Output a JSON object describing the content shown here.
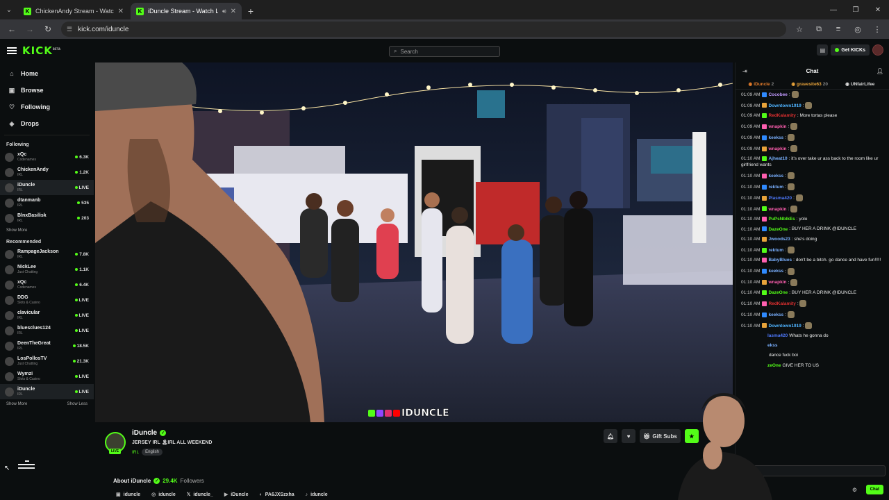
{
  "browser": {
    "tabs": [
      {
        "title": "ChickenAndy Stream - Watch Li"
      },
      {
        "title": "iDuncle Stream - Watch Live"
      }
    ],
    "url": "kick.com/iduncle"
  },
  "header": {
    "logo": "KICK",
    "logo_sup": "BETA",
    "search_placeholder": "Search",
    "get_kicks": "Get KICKs"
  },
  "sidebar": {
    "nav": [
      {
        "label": "Home",
        "icon": "home-icon"
      },
      {
        "label": "Browse",
        "icon": "browse-icon"
      },
      {
        "label": "Following",
        "icon": "heart-icon"
      },
      {
        "label": "Drops",
        "icon": "drop-icon"
      }
    ],
    "following_title": "Following",
    "following": [
      {
        "name": "xQc",
        "cat": "Codenames",
        "viewers": "6.3K"
      },
      {
        "name": "ChickenAndy",
        "cat": "IRL",
        "viewers": "1.2K"
      },
      {
        "name": "iDuncle",
        "cat": "IRL",
        "viewers": "LIVE"
      },
      {
        "name": "dtanmanb",
        "cat": "IRL",
        "viewers": "535"
      },
      {
        "name": "BlnxBasilisk",
        "cat": "IRL",
        "viewers": "203"
      }
    ],
    "show_more_1": "Show More",
    "recommended_title": "Recommended",
    "recommended": [
      {
        "name": "RampageJackson",
        "cat": "IRL",
        "viewers": "7.8K"
      },
      {
        "name": "NickLee",
        "cat": "Just Chatting",
        "viewers": "1.1K"
      },
      {
        "name": "xQc",
        "cat": "Codenames",
        "viewers": "6.4K"
      },
      {
        "name": "DDG",
        "cat": "Slots & Casino",
        "viewers": "LIVE"
      },
      {
        "name": "clavicular",
        "cat": "IRL",
        "viewers": "LIVE"
      },
      {
        "name": "bluesclues124",
        "cat": "IRL",
        "viewers": "LIVE"
      },
      {
        "name": "DeenTheGreat",
        "cat": "IRL",
        "viewers": "18.5K"
      },
      {
        "name": "LosPollosTV",
        "cat": "Just Chatting",
        "viewers": "21.3K"
      },
      {
        "name": "Wymzi",
        "cat": "Slots & Casino",
        "viewers": "LIVE"
      },
      {
        "name": "iDuncle",
        "cat": "IRL",
        "viewers": "LIVE"
      }
    ],
    "show_more_2": "Show More",
    "show_less": "Show Less"
  },
  "video": {
    "watermark": "IDUNCLE"
  },
  "streamer": {
    "name": "iDuncle",
    "live_tag": "LIVE",
    "title": "JERSEY IRL 🏝IRL ALL WEEKEND",
    "category": "IRL",
    "tag": "English",
    "gift_subs": "Gift Subs",
    "about_label": "About iDuncle",
    "followers": "29.4K",
    "followers_label": "Followers",
    "socials": [
      "iduncle",
      "iduncle",
      "iduncle_",
      "iDuncle",
      "PA6JXSzxha",
      "iduncle"
    ]
  },
  "chat": {
    "title": "Chat",
    "gifters": [
      {
        "name": "iDuncle",
        "count": "2",
        "color": "#e07a2a"
      },
      {
        "name": "gravesite63",
        "count": "20",
        "color": "#e8a33a"
      },
      {
        "name": "UNfairLifee",
        "count": "",
        "color": "#dddddd"
      }
    ],
    "messages": [
      {
        "time": "01:09 AM",
        "user": "Cocobee",
        "color": "#c39bff",
        "text": ""
      },
      {
        "time": "01:09 AM",
        "user": "Downtown1919",
        "color": "#4fb3ff",
        "text": ""
      },
      {
        "time": "01:09 AM",
        "user": "RedKalamity",
        "color": "#e03030",
        "text": "More tortas please"
      },
      {
        "time": "01:09 AM",
        "user": "wnapkin",
        "color": "#ff5fb0",
        "text": ""
      },
      {
        "time": "01:09 AM",
        "user": "keekss",
        "color": "#7ab0ff",
        "text": ""
      },
      {
        "time": "01:09 AM",
        "user": "wnapkin",
        "color": "#ff5fb0",
        "text": ""
      },
      {
        "time": "01:10 AM",
        "user": "Ajheat10",
        "color": "#7ab0ff",
        "text": "it's over take ur ass back to the room like ur girlfriend wants"
      },
      {
        "time": "01:10 AM",
        "user": "keekss",
        "color": "#7ab0ff",
        "text": ""
      },
      {
        "time": "01:10 AM",
        "user": "rektum",
        "color": "#7ab0ff",
        "text": ""
      },
      {
        "time": "01:10 AM",
        "user": "Plasma420",
        "color": "#4f7aff",
        "text": ""
      },
      {
        "time": "01:10 AM",
        "user": "wnapkin",
        "color": "#ff5fb0",
        "text": ""
      },
      {
        "time": "01:10 AM",
        "user": "PuPsNbIkEs",
        "color": "#53fc18",
        "text": "yolo"
      },
      {
        "time": "01:10 AM",
        "user": "DazeOne",
        "color": "#53fc18",
        "text": "BUY HER A DRINK @IDUNCLE"
      },
      {
        "time": "01:10 AM",
        "user": "Jwoods23",
        "color": "#7ab0ff",
        "text": "she's doing"
      },
      {
        "time": "01:10 AM",
        "user": "rektum",
        "color": "#7ab0ff",
        "text": ""
      },
      {
        "time": "01:10 AM",
        "user": "BabyBlues",
        "color": "#7ab0ff",
        "text": "don't be a bitch. go dance and have fun!!!!!"
      },
      {
        "time": "01:10 AM",
        "user": "keekss",
        "color": "#7ab0ff",
        "text": ""
      },
      {
        "time": "01:10 AM",
        "user": "wnapkin",
        "color": "#ff5fb0",
        "text": ""
      },
      {
        "time": "01:10 AM",
        "user": "DazeOne",
        "color": "#53fc18",
        "text": "BUY HER A DRINK @IDUNCLE"
      },
      {
        "time": "01:10 AM",
        "user": "RedKalamity",
        "color": "#e03030",
        "text": ""
      },
      {
        "time": "01:10 AM",
        "user": "keekss",
        "color": "#7ab0ff",
        "text": ""
      },
      {
        "time": "01:10 AM",
        "user": "Downtown1919",
        "color": "#4fb3ff",
        "text": ""
      }
    ],
    "partial": [
      {
        "user": "lasma420",
        "color": "#4f7aff",
        "text": "Whats he gonna do"
      },
      {
        "user": "ekss",
        "color": "#7ab0ff",
        "text": ""
      },
      {
        "user": "",
        "color": "#ffffff",
        "text": "dance fuck boi"
      },
      {
        "user": "zeOne",
        "color": "#53fc18",
        "text": "GIVE HER TO US"
      }
    ],
    "send_label": "Chat"
  }
}
